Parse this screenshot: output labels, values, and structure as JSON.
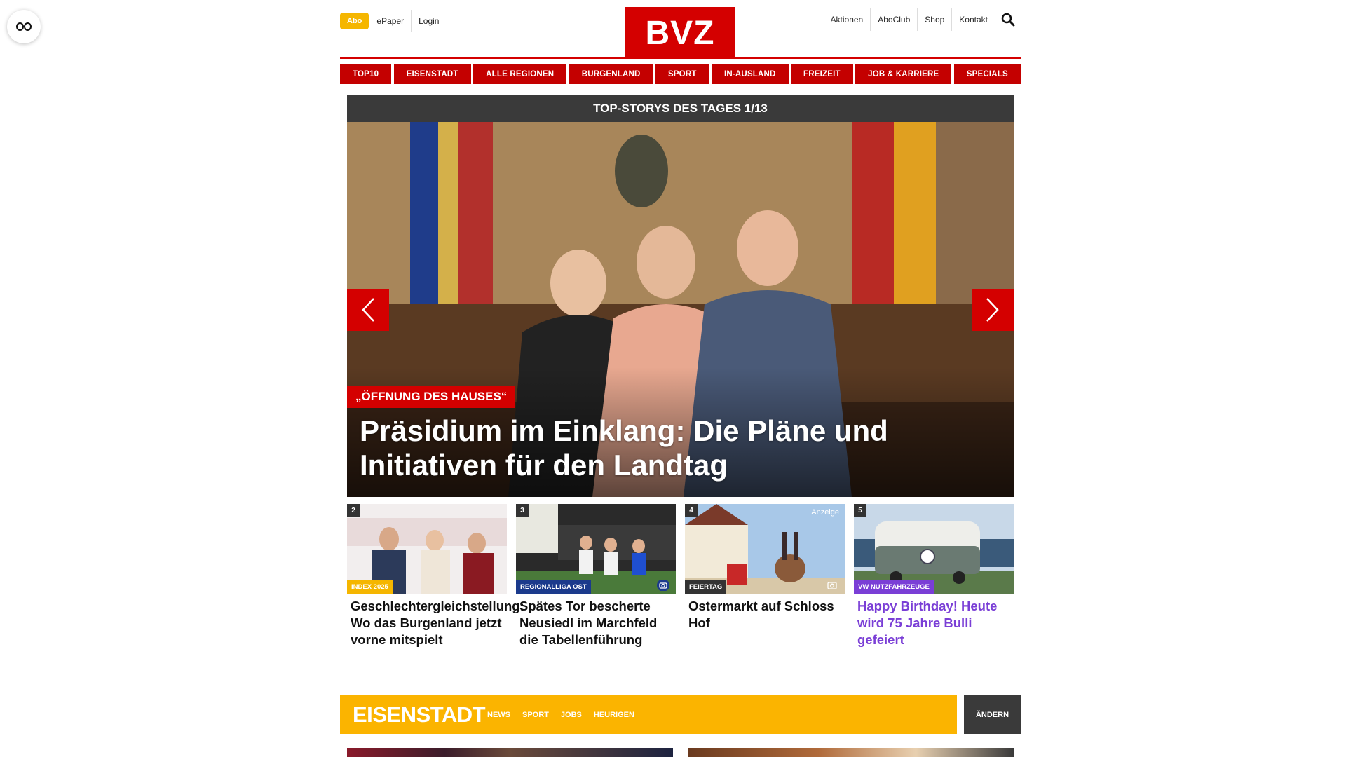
{
  "header": {
    "abo_label": "Abo",
    "epaper_label": "ePaper",
    "login_label": "Login",
    "logo_text": "BVZ",
    "right_links": [
      "Aktionen",
      "AboClub",
      "Shop",
      "Kontakt"
    ]
  },
  "nav": {
    "items": [
      "TOP10",
      "EISENSTADT",
      "ALLE REGIONEN",
      "BURGENLAND",
      "SPORT",
      "IN-AUSLAND",
      "FREIZEIT",
      "JOB & KARRIERE",
      "SPECIALS"
    ]
  },
  "hero": {
    "bar_label": "TOP-STORYS DES TAGES 1/13",
    "kicker": "„ÖFFNUNG DES HAUSES“",
    "title": "Präsidium im Einklang: Die Pläne und Initiativen für den Landtag"
  },
  "teasers": [
    {
      "number": "2",
      "tag": "INDEX 2025",
      "tag_color": "#f5b600",
      "title": "Geschlechtergleichstellung: Wo das Burgenland jetzt vorne mitspielt"
    },
    {
      "number": "3",
      "tag": "REGIONALLIGA OST",
      "tag_color": "#1b3a8c",
      "title": "Spätes Tor bescherte Neusiedl im Marchfeld die Tabellenführung"
    },
    {
      "number": "4",
      "tag": "FEIERTAG",
      "tag_color": "#333333",
      "anzeige": "Anzeige",
      "title": "Ostermarkt auf Schloss Hof"
    },
    {
      "number": "5",
      "tag": "VW NUTZFAHRZEUGE",
      "tag_color": "#7a3ed6",
      "title": "Happy Birthday! Heute wird 75 Jahre Bulli gefeiert"
    }
  ],
  "section": {
    "title": "EISENSTADT",
    "links": [
      "NEWS",
      "SPORT",
      "JOBS",
      "HEURIGEN"
    ],
    "change_label": "ÄNDERN"
  },
  "colors": {
    "brand_red": "#d40000",
    "abo_yellow": "#f5b600",
    "section_yellow": "#fbb400",
    "dark_bar": "#3a3a3a"
  },
  "icons": [
    "reader-mode-icon",
    "search-icon",
    "chevron-left-icon",
    "chevron-right-icon",
    "camera-icon"
  ]
}
